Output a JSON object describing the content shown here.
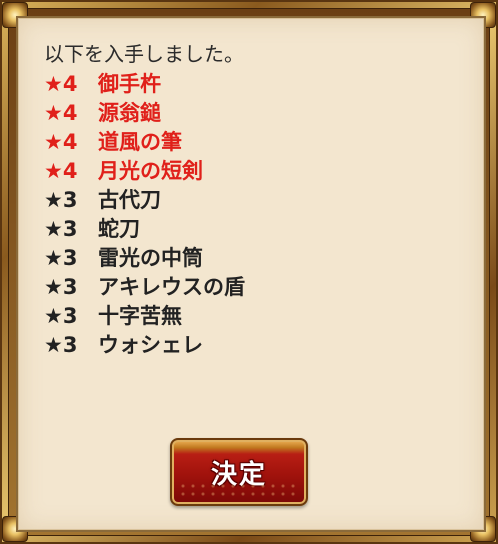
{
  "dialog": {
    "header": "以下を入手しました。",
    "items": [
      {
        "star": "★4",
        "name": "御手杵",
        "rarity": 4
      },
      {
        "star": "★4",
        "name": "源翁鎚",
        "rarity": 4
      },
      {
        "star": "★4",
        "name": "道風の筆",
        "rarity": 4
      },
      {
        "star": "★4",
        "name": "月光の短剣",
        "rarity": 4
      },
      {
        "star": "★3",
        "name": "古代刀",
        "rarity": 3
      },
      {
        "star": "★3",
        "name": "蛇刀",
        "rarity": 3
      },
      {
        "star": "★3",
        "name": "雷光の中筒",
        "rarity": 3
      },
      {
        "star": "★3",
        "name": "アキレウスの盾",
        "rarity": 3
      },
      {
        "star": "★3",
        "name": "十字苦無",
        "rarity": 3
      },
      {
        "star": "★3",
        "name": "ウォシェレ",
        "rarity": 3
      }
    ],
    "confirm_label": "決定"
  },
  "colors": {
    "rarity4": "#e0201a",
    "rarity3": "#222222",
    "panel_bg": "#f3e6cf",
    "button_red": "#a0120c",
    "frame_gold": "#d9b25a"
  }
}
